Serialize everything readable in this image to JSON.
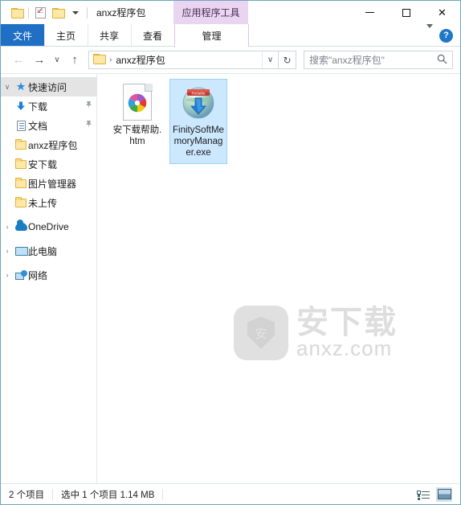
{
  "window": {
    "title": "anxz程序包",
    "contextual_tab_group": "应用程序工具",
    "quick_access": [
      {
        "name": "folder-icon",
        "label": ""
      },
      {
        "name": "properties-icon",
        "label": ""
      },
      {
        "name": "new-folder-icon",
        "label": ""
      }
    ],
    "controls": {
      "minimize": "–",
      "maximize": "□",
      "close": "✕"
    }
  },
  "ribbon": {
    "tabs": [
      {
        "label": "文件",
        "selected": true
      },
      {
        "label": "主页",
        "selected": false
      },
      {
        "label": "共享",
        "selected": false
      },
      {
        "label": "查看",
        "selected": false
      },
      {
        "label": "管理",
        "selected": false,
        "contextual": true
      }
    ],
    "collapse_glyph": "∨",
    "help_glyph": "?"
  },
  "addressbar": {
    "back_glyph": "←",
    "forward_glyph": "→",
    "recent_glyph": "∨",
    "up_glyph": "↑",
    "separator": "›",
    "path": "anxz程序包",
    "dropdown_glyph": "∨",
    "refresh_glyph": "↻"
  },
  "search": {
    "placeholder": "搜索\"anxz程序包\"",
    "icon_glyph": "⌕"
  },
  "sidebar": {
    "items": [
      {
        "label": "快速访问",
        "icon": "pin-star-icon",
        "expander": "∨",
        "selected": true,
        "indent": false,
        "pinned": false
      },
      {
        "label": "下载",
        "icon": "download-arrow-icon",
        "expander": "",
        "selected": false,
        "indent": true,
        "pinned": true
      },
      {
        "label": "文档",
        "icon": "document-icon",
        "expander": "",
        "selected": false,
        "indent": true,
        "pinned": true
      },
      {
        "label": "anxz程序包",
        "icon": "folder-icon",
        "expander": "",
        "selected": false,
        "indent": true,
        "pinned": false
      },
      {
        "label": "安下载",
        "icon": "folder-icon",
        "expander": "",
        "selected": false,
        "indent": true,
        "pinned": false
      },
      {
        "label": "图片管理器",
        "icon": "folder-icon",
        "expander": "",
        "selected": false,
        "indent": true,
        "pinned": false
      },
      {
        "label": "未上传",
        "icon": "folder-icon",
        "expander": "",
        "selected": false,
        "indent": true,
        "pinned": false
      },
      {
        "label": "OneDrive",
        "icon": "cloud-icon",
        "expander": "›",
        "selected": false,
        "indent": false,
        "pinned": false
      },
      {
        "label": "此电脑",
        "icon": "this-pc-icon",
        "expander": "›",
        "selected": false,
        "indent": false,
        "pinned": false
      },
      {
        "label": "网络",
        "icon": "network-icon",
        "expander": "›",
        "selected": false,
        "indent": false,
        "pinned": false
      }
    ],
    "pin_glyph": "📌"
  },
  "files": [
    {
      "name": "安下载帮助.htm",
      "icon": "html-document-icon",
      "selected": false
    },
    {
      "name": "FinitySoftMemoryManager.exe",
      "icon": "installer-globe-icon",
      "selected": true
    }
  ],
  "watermark": {
    "shield_char": "安",
    "cn_text": "安下载",
    "en_text": "anxz.com"
  },
  "statusbar": {
    "item_count": "2 个项目",
    "selection": "选中 1 个项目  1.14 MB",
    "views": [
      {
        "name": "details-view-button",
        "active": false
      },
      {
        "name": "large-icons-view-button",
        "active": true
      }
    ]
  },
  "colors": {
    "accent": "#1f6fc4",
    "selection": "#cce8ff",
    "contextual_tab": "#e9d5f0",
    "window_border": "#6ca6c1"
  }
}
